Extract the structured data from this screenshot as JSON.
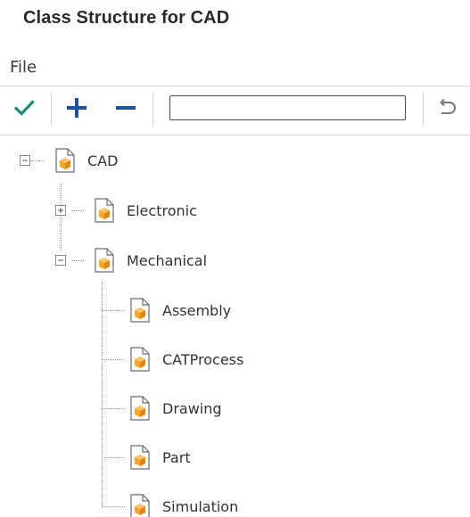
{
  "page": {
    "title": "Class Structure for CAD"
  },
  "menu": {
    "file_label": "File"
  },
  "toolbar": {
    "search_value": "",
    "icons": {
      "confirm": "checkmark-icon",
      "add": "plus-icon",
      "remove": "minus-icon",
      "undo": "undo-icon"
    },
    "colors": {
      "confirm": "#1e8a7a",
      "add_remove": "#1f4fa3",
      "undo": "#7a7a7a"
    }
  },
  "tree": {
    "root": {
      "label": "CAD",
      "expanded": true,
      "icon": "class-file-icon"
    },
    "children": [
      {
        "label": "Electronic",
        "expanded": false,
        "icon": "class-file-icon"
      },
      {
        "label": "Mechanical",
        "expanded": true,
        "icon": "class-file-icon"
      }
    ],
    "mechanical_children": [
      {
        "label": "Assembly",
        "icon": "class-file-icon"
      },
      {
        "label": "CATProcess",
        "icon": "class-file-icon"
      },
      {
        "label": "Drawing",
        "icon": "class-file-icon"
      },
      {
        "label": "Part",
        "icon": "class-file-icon"
      },
      {
        "label": "Simulation",
        "icon": "class-file-icon"
      }
    ],
    "icon_colors": {
      "cube": "#f5a623",
      "cube_dark": "#d9861a",
      "page_stroke": "#6b6b6b"
    }
  }
}
